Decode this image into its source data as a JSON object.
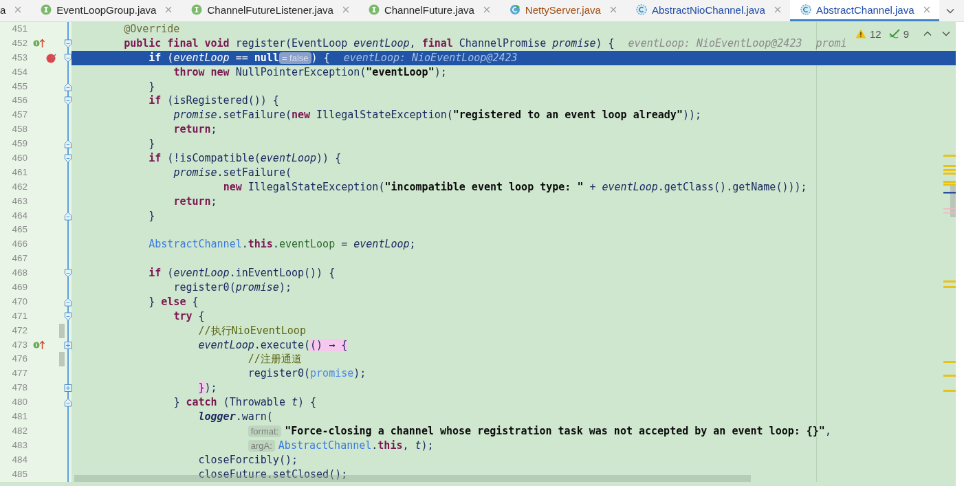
{
  "tabs": [
    {
      "label": "a",
      "kind": "plain",
      "color": "#1f1f1f",
      "selected": false
    },
    {
      "label": "EventLoopGroup.java",
      "kind": "interface",
      "color": "#1f1f1f",
      "selected": false
    },
    {
      "label": "ChannelFutureListener.java",
      "kind": "interface",
      "color": "#1f1f1f",
      "selected": false
    },
    {
      "label": "ChannelFuture.java",
      "kind": "interface",
      "color": "#1f1f1f",
      "selected": false
    },
    {
      "label": "NettyServer.java",
      "kind": "runnable",
      "color": "#a04a10",
      "selected": false
    },
    {
      "label": "AbstractNioChannel.java",
      "kind": "abstract",
      "color": "#1f4aa8",
      "selected": false
    },
    {
      "label": "AbstractChannel.java",
      "kind": "abstract",
      "color": "#1f4aa8",
      "selected": true
    }
  ],
  "inspection": {
    "warnings": "12",
    "checks": "9"
  },
  "lines": [
    {
      "no": "451",
      "changed": false,
      "current": false,
      "tokens": [
        {
          "t": "    @Override",
          "kind": "annot"
        }
      ]
    },
    {
      "no": "452",
      "changed": false,
      "current": false,
      "gutter": [
        {
          "kind": "implements"
        },
        {
          "kind": "fold-start"
        }
      ],
      "tokens": [
        {
          "t": "    public final void ",
          "kind": "kw"
        },
        {
          "t": "register(",
          "kind": "plain"
        },
        {
          "t": "EventLoop ",
          "kind": "type"
        },
        {
          "t": "eventLoop",
          "kind": "param"
        },
        {
          "t": ", ",
          "kind": "plain"
        },
        {
          "t": "final ",
          "kind": "kw"
        },
        {
          "t": "ChannelPromise ",
          "kind": "type"
        },
        {
          "t": "promise",
          "kind": "param"
        },
        {
          "t": ") {",
          "kind": "plain"
        },
        {
          "t": "eventLoop: NioEventLoop@2423",
          "kind": "inlay"
        },
        {
          "t": "promi",
          "kind": "inlay"
        }
      ]
    },
    {
      "no": "453",
      "changed": false,
      "current": true,
      "gutter": [
        {
          "kind": "breakpoint"
        },
        {
          "kind": "fold-start"
        }
      ],
      "tokens": [
        {
          "t": "        if ",
          "kind": "kw"
        },
        {
          "t": "(",
          "kind": "plain"
        },
        {
          "t": "eventLoop",
          "kind": "param"
        },
        {
          "t": " == ",
          "kind": "plain"
        },
        {
          "t": "null",
          "kind": "kw"
        },
        {
          "t": "= false",
          "kind": "pill"
        },
        {
          "t": ") {",
          "kind": "plain"
        },
        {
          "t": "eventLoop: NioEventLoop@2423",
          "kind": "inlay"
        }
      ]
    },
    {
      "no": "454",
      "changed": false,
      "current": false,
      "tokens": [
        {
          "t": "            throw new ",
          "kind": "kw"
        },
        {
          "t": "NullPointerException(",
          "kind": "plain"
        },
        {
          "t": "\"eventLoop\"",
          "kind": "str"
        },
        {
          "t": ");",
          "kind": "plain"
        }
      ]
    },
    {
      "no": "455",
      "changed": false,
      "current": false,
      "gutter": [
        {
          "kind": "fold-end"
        }
      ],
      "tokens": [
        {
          "t": "        }",
          "kind": "plain"
        }
      ]
    },
    {
      "no": "456",
      "changed": false,
      "current": false,
      "gutter": [
        {
          "kind": "fold-start"
        }
      ],
      "tokens": [
        {
          "t": "        if ",
          "kind": "kw"
        },
        {
          "t": "(isRegistered()) {",
          "kind": "plain"
        }
      ]
    },
    {
      "no": "457",
      "changed": false,
      "current": false,
      "tokens": [
        {
          "t": "            promise",
          "kind": "param"
        },
        {
          "t": ".setFailure(",
          "kind": "plain"
        },
        {
          "t": "new ",
          "kind": "kw"
        },
        {
          "t": "IllegalStateException(",
          "kind": "plain"
        },
        {
          "t": "\"registered to an event loop already\"",
          "kind": "str"
        },
        {
          "t": "));",
          "kind": "plain"
        }
      ]
    },
    {
      "no": "458",
      "changed": false,
      "current": false,
      "tokens": [
        {
          "t": "            return",
          "kind": "kw"
        },
        {
          "t": ";",
          "kind": "plain"
        }
      ]
    },
    {
      "no": "459",
      "changed": false,
      "current": false,
      "gutter": [
        {
          "kind": "fold-end"
        }
      ],
      "tokens": [
        {
          "t": "        }",
          "kind": "plain"
        }
      ]
    },
    {
      "no": "460",
      "changed": false,
      "current": false,
      "gutter": [
        {
          "kind": "fold-start"
        }
      ],
      "tokens": [
        {
          "t": "        if ",
          "kind": "kw"
        },
        {
          "t": "(!isCompatible(",
          "kind": "plain"
        },
        {
          "t": "eventLoop",
          "kind": "param"
        },
        {
          "t": ")) {",
          "kind": "plain"
        }
      ]
    },
    {
      "no": "461",
      "changed": false,
      "current": false,
      "tokens": [
        {
          "t": "            promise",
          "kind": "param"
        },
        {
          "t": ".setFailure(",
          "kind": "plain"
        }
      ]
    },
    {
      "no": "462",
      "changed": false,
      "current": false,
      "tokens": [
        {
          "t": "                    new ",
          "kind": "kw"
        },
        {
          "t": "IllegalStateException(",
          "kind": "plain"
        },
        {
          "t": "\"incompatible event loop type: \"",
          "kind": "str"
        },
        {
          "t": " + ",
          "kind": "plain"
        },
        {
          "t": "eventLoop",
          "kind": "param"
        },
        {
          "t": ".getClass().getName()));",
          "kind": "plain"
        }
      ]
    },
    {
      "no": "463",
      "changed": false,
      "current": false,
      "tokens": [
        {
          "t": "            return",
          "kind": "kw"
        },
        {
          "t": ";",
          "kind": "plain"
        }
      ]
    },
    {
      "no": "464",
      "changed": false,
      "current": false,
      "gutter": [
        {
          "kind": "fold-end"
        }
      ],
      "tokens": [
        {
          "t": "        }",
          "kind": "plain"
        }
      ]
    },
    {
      "no": "465",
      "changed": false,
      "current": false
    },
    {
      "no": "466",
      "changed": false,
      "current": false,
      "tokens": [
        {
          "t": "        AbstractChannel",
          "kind": "ref"
        },
        {
          "t": ".",
          "kind": "plain"
        },
        {
          "t": "this",
          "kind": "kw"
        },
        {
          "t": ".",
          "kind": "plain"
        },
        {
          "t": "eventLoop",
          "kind": "field"
        },
        {
          "t": " = ",
          "kind": "plain"
        },
        {
          "t": "eventLoop",
          "kind": "param"
        },
        {
          "t": ";",
          "kind": "plain"
        }
      ]
    },
    {
      "no": "467",
      "changed": false,
      "current": false
    },
    {
      "no": "468",
      "changed": false,
      "current": false,
      "gutter": [
        {
          "kind": "fold-start"
        }
      ],
      "tokens": [
        {
          "t": "        if ",
          "kind": "kw"
        },
        {
          "t": "(",
          "kind": "plain"
        },
        {
          "t": "eventLoop",
          "kind": "param"
        },
        {
          "t": ".inEventLoop()) {",
          "kind": "plain"
        }
      ]
    },
    {
      "no": "469",
      "changed": false,
      "current": false,
      "tokens": [
        {
          "t": "            register0(",
          "kind": "plain"
        },
        {
          "t": "promise",
          "kind": "param"
        },
        {
          "t": ");",
          "kind": "plain"
        }
      ]
    },
    {
      "no": "470",
      "changed": false,
      "current": false,
      "gutter": [
        {
          "kind": "fold-end"
        }
      ],
      "tokens": [
        {
          "t": "        } ",
          "kind": "plain"
        },
        {
          "t": "else",
          "kind": "kw"
        },
        {
          "t": " {",
          "kind": "plain"
        }
      ]
    },
    {
      "no": "471",
      "changed": false,
      "current": false,
      "gutter": [
        {
          "kind": "fold-start"
        }
      ],
      "tokens": [
        {
          "t": "            try",
          "kind": "kw"
        },
        {
          "t": " {",
          "kind": "plain"
        }
      ]
    },
    {
      "no": "472",
      "changed": true,
      "current": false,
      "tokens": [
        {
          "t": "                //执行NioEventLoop",
          "kind": "comment"
        }
      ]
    },
    {
      "no": "473",
      "changed": false,
      "current": false,
      "gutter": [
        {
          "kind": "implements"
        },
        {
          "kind": "fold-plus"
        }
      ],
      "tokens": [
        {
          "t": "                eventLoop",
          "kind": "param"
        },
        {
          "t": ".execute(",
          "kind": "plain"
        },
        {
          "t": "() → {",
          "kind": "match"
        }
      ]
    },
    {
      "no": "476",
      "changed": true,
      "current": false,
      "tokens": [
        {
          "t": "                        //注册通道",
          "kind": "comment"
        }
      ]
    },
    {
      "no": "477",
      "changed": false,
      "current": false,
      "tokens": [
        {
          "t": "                        register0(",
          "kind": "plain"
        },
        {
          "t": "promise",
          "kind": "cap"
        },
        {
          "t": ");",
          "kind": "plain"
        }
      ]
    },
    {
      "no": "478",
      "changed": false,
      "current": false,
      "gutter": [
        {
          "kind": "fold-plus"
        }
      ],
      "tokens": [
        {
          "t": "                }",
          "kind": "match"
        },
        {
          "t": ");",
          "kind": "plain"
        }
      ]
    },
    {
      "no": "480",
      "changed": false,
      "current": false,
      "gutter": [
        {
          "kind": "fold-end"
        }
      ],
      "tokens": [
        {
          "t": "            } ",
          "kind": "plain"
        },
        {
          "t": "catch",
          "kind": "kw"
        },
        {
          "t": " (",
          "kind": "plain"
        },
        {
          "t": "Throwable ",
          "kind": "type"
        },
        {
          "t": "t",
          "kind": "param"
        },
        {
          "t": ") {",
          "kind": "plain"
        }
      ]
    },
    {
      "no": "481",
      "changed": false,
      "current": false,
      "tokens": [
        {
          "t": "                logger",
          "kind": "static"
        },
        {
          "t": ".warn(",
          "kind": "plain"
        }
      ]
    },
    {
      "no": "482",
      "changed": false,
      "current": false,
      "tokens": [
        {
          "t": "                        format:",
          "kind": "pill"
        },
        {
          "t": "\"Force-closing a channel whose registration task was not accepted by an event loop: {}\"",
          "kind": "str"
        },
        {
          "t": ",",
          "kind": "plain"
        }
      ]
    },
    {
      "no": "483",
      "changed": false,
      "current": false,
      "tokens": [
        {
          "t": "                        argA:",
          "kind": "pill"
        },
        {
          "t": "AbstractChannel",
          "kind": "ref"
        },
        {
          "t": ".",
          "kind": "plain"
        },
        {
          "t": "this",
          "kind": "kw"
        },
        {
          "t": ", ",
          "kind": "plain"
        },
        {
          "t": "t",
          "kind": "param"
        },
        {
          "t": ");",
          "kind": "plain"
        }
      ]
    },
    {
      "no": "484",
      "changed": false,
      "current": false,
      "tokens": [
        {
          "t": "                closeForcibly();",
          "kind": "plain"
        }
      ]
    },
    {
      "no": "485",
      "changed": false,
      "current": false,
      "tokens": [
        {
          "t": "                closeFuture.setClosed();",
          "kind": "plain"
        }
      ]
    }
  ]
}
